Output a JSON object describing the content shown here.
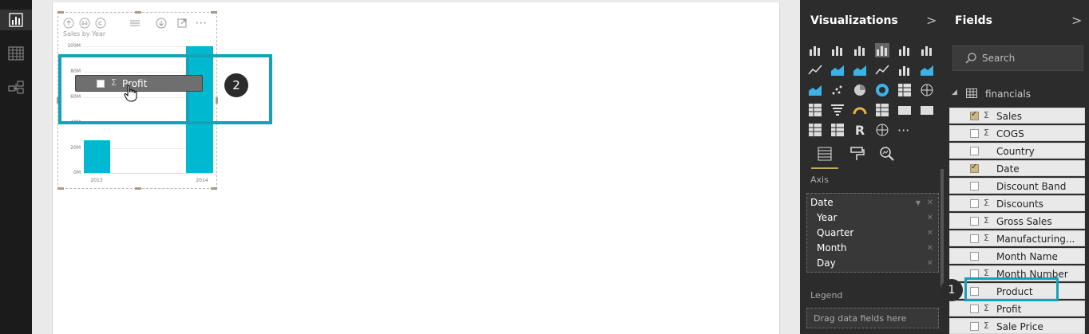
{
  "left_rail": {
    "items": [
      {
        "name": "report-view"
      },
      {
        "name": "data-view"
      },
      {
        "name": "relationships-view"
      }
    ]
  },
  "visual": {
    "title": "Sales by Year",
    "y_ticks": [
      "100M",
      "80M",
      "60M",
      "40M",
      "20M",
      "0M"
    ],
    "x_ticks": [
      "2013",
      "2014"
    ],
    "drag_ghost_label": "Profit",
    "drag_ghost_sigma": "Σ"
  },
  "chart_data": {
    "type": "bar",
    "title": "Sales by Year",
    "categories": [
      "2013",
      "2014"
    ],
    "values": [
      26,
      100
    ],
    "ylim": [
      0,
      100
    ],
    "y_unit": "M",
    "color": "#01b8d1"
  },
  "steps": {
    "one": "1",
    "two": "2"
  },
  "visualizations": {
    "title": "Visualizations",
    "chevron": ">",
    "more": "···",
    "axis_label": "Axis",
    "axis_items": [
      {
        "label": "Date"
      },
      {
        "label": "Year"
      },
      {
        "label": "Quarter"
      },
      {
        "label": "Month"
      },
      {
        "label": "Day"
      }
    ],
    "remove_glyph": "✕",
    "legend_label": "Legend",
    "drop_placeholder": "Drag data fields here"
  },
  "fields": {
    "title": "Fields",
    "chevron": ">",
    "search_placeholder": "Search",
    "table_name": "financials",
    "items": [
      {
        "label": "Sales",
        "sigma": "Σ",
        "checked": true
      },
      {
        "label": "COGS",
        "sigma": "Σ",
        "checked": false
      },
      {
        "label": "Country",
        "sigma": "",
        "checked": false
      },
      {
        "label": "Date",
        "sigma": "",
        "checked": true
      },
      {
        "label": "Discount Band",
        "sigma": "",
        "checked": false
      },
      {
        "label": "Discounts",
        "sigma": "Σ",
        "checked": false
      },
      {
        "label": "Gross Sales",
        "sigma": "Σ",
        "checked": false
      },
      {
        "label": "Manufacturing...",
        "sigma": "Σ",
        "checked": false
      },
      {
        "label": "Month Name",
        "sigma": "",
        "checked": false
      },
      {
        "label": "Month Number",
        "sigma": "Σ",
        "checked": false
      },
      {
        "label": "Product",
        "sigma": "",
        "checked": false
      },
      {
        "label": "Profit",
        "sigma": "Σ",
        "checked": false
      },
      {
        "label": "Sale Price",
        "sigma": "Σ",
        "checked": false
      }
    ]
  },
  "colors": {
    "accent": "#13a3b9",
    "bar": "#01b8d1",
    "pane": "#2c2c2c",
    "gold": "#c5a75b"
  }
}
